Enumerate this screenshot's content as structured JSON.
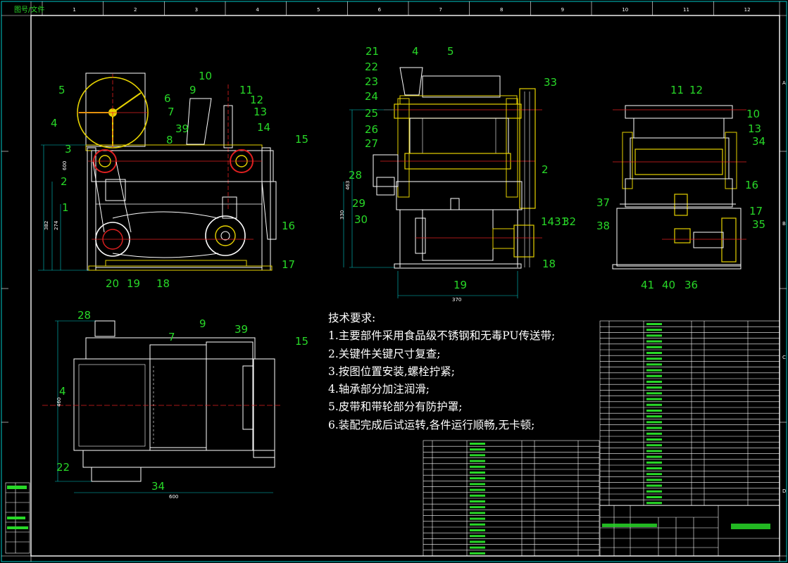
{
  "header_tag": "图号/文件",
  "tech_requirements": {
    "title": "技术要求:",
    "items": [
      "1.主要部件采用食品级不锈钢和无毒PU传送带;",
      "2.关键件关键尺寸复查;",
      "3.按图位置安装,螺栓拧紧;",
      "4.轴承部分加注润滑;",
      "5.皮带和带轮部分有防护罩;",
      "6.装配完成后试运转,各件运行顺畅,无卡顿;"
    ]
  },
  "grid_numbers_top": [
    "1",
    "2",
    "3",
    "4",
    "5",
    "6",
    "7",
    "8",
    "9",
    "10",
    "11",
    "12"
  ],
  "front_view": {
    "callouts": [
      "5",
      "4",
      "3",
      "2",
      "1",
      "20",
      "19",
      "18",
      "17",
      "16",
      "15",
      "14",
      "13",
      "12",
      "11",
      "10",
      "9",
      "8",
      "7",
      "6",
      "39"
    ],
    "dims": [
      "600",
      "382",
      "274"
    ]
  },
  "side_view": {
    "callouts": [
      "21",
      "22",
      "23",
      "24",
      "25",
      "26",
      "27",
      "28",
      "29",
      "30",
      "19",
      "18",
      "4",
      "5",
      "33",
      "2",
      "14",
      "31",
      "32",
      "43"
    ],
    "dims": [
      "463",
      "330",
      "370"
    ]
  },
  "right_view": {
    "callouts": [
      "11",
      "12",
      "10",
      "13",
      "34",
      "16",
      "17",
      "35",
      "37",
      "38",
      "41",
      "40",
      "36"
    ]
  },
  "top_view": {
    "callouts": [
      "28",
      "7",
      "9",
      "39",
      "15",
      "4",
      "22",
      "34"
    ],
    "dims": [
      "600",
      "460"
    ]
  },
  "colors": {
    "frame": "#ffffff",
    "green": "#28d828",
    "yellow": "#e6d200",
    "red": "#e02020",
    "cyan": "#00c8c8",
    "magenta": "#d040d0"
  }
}
